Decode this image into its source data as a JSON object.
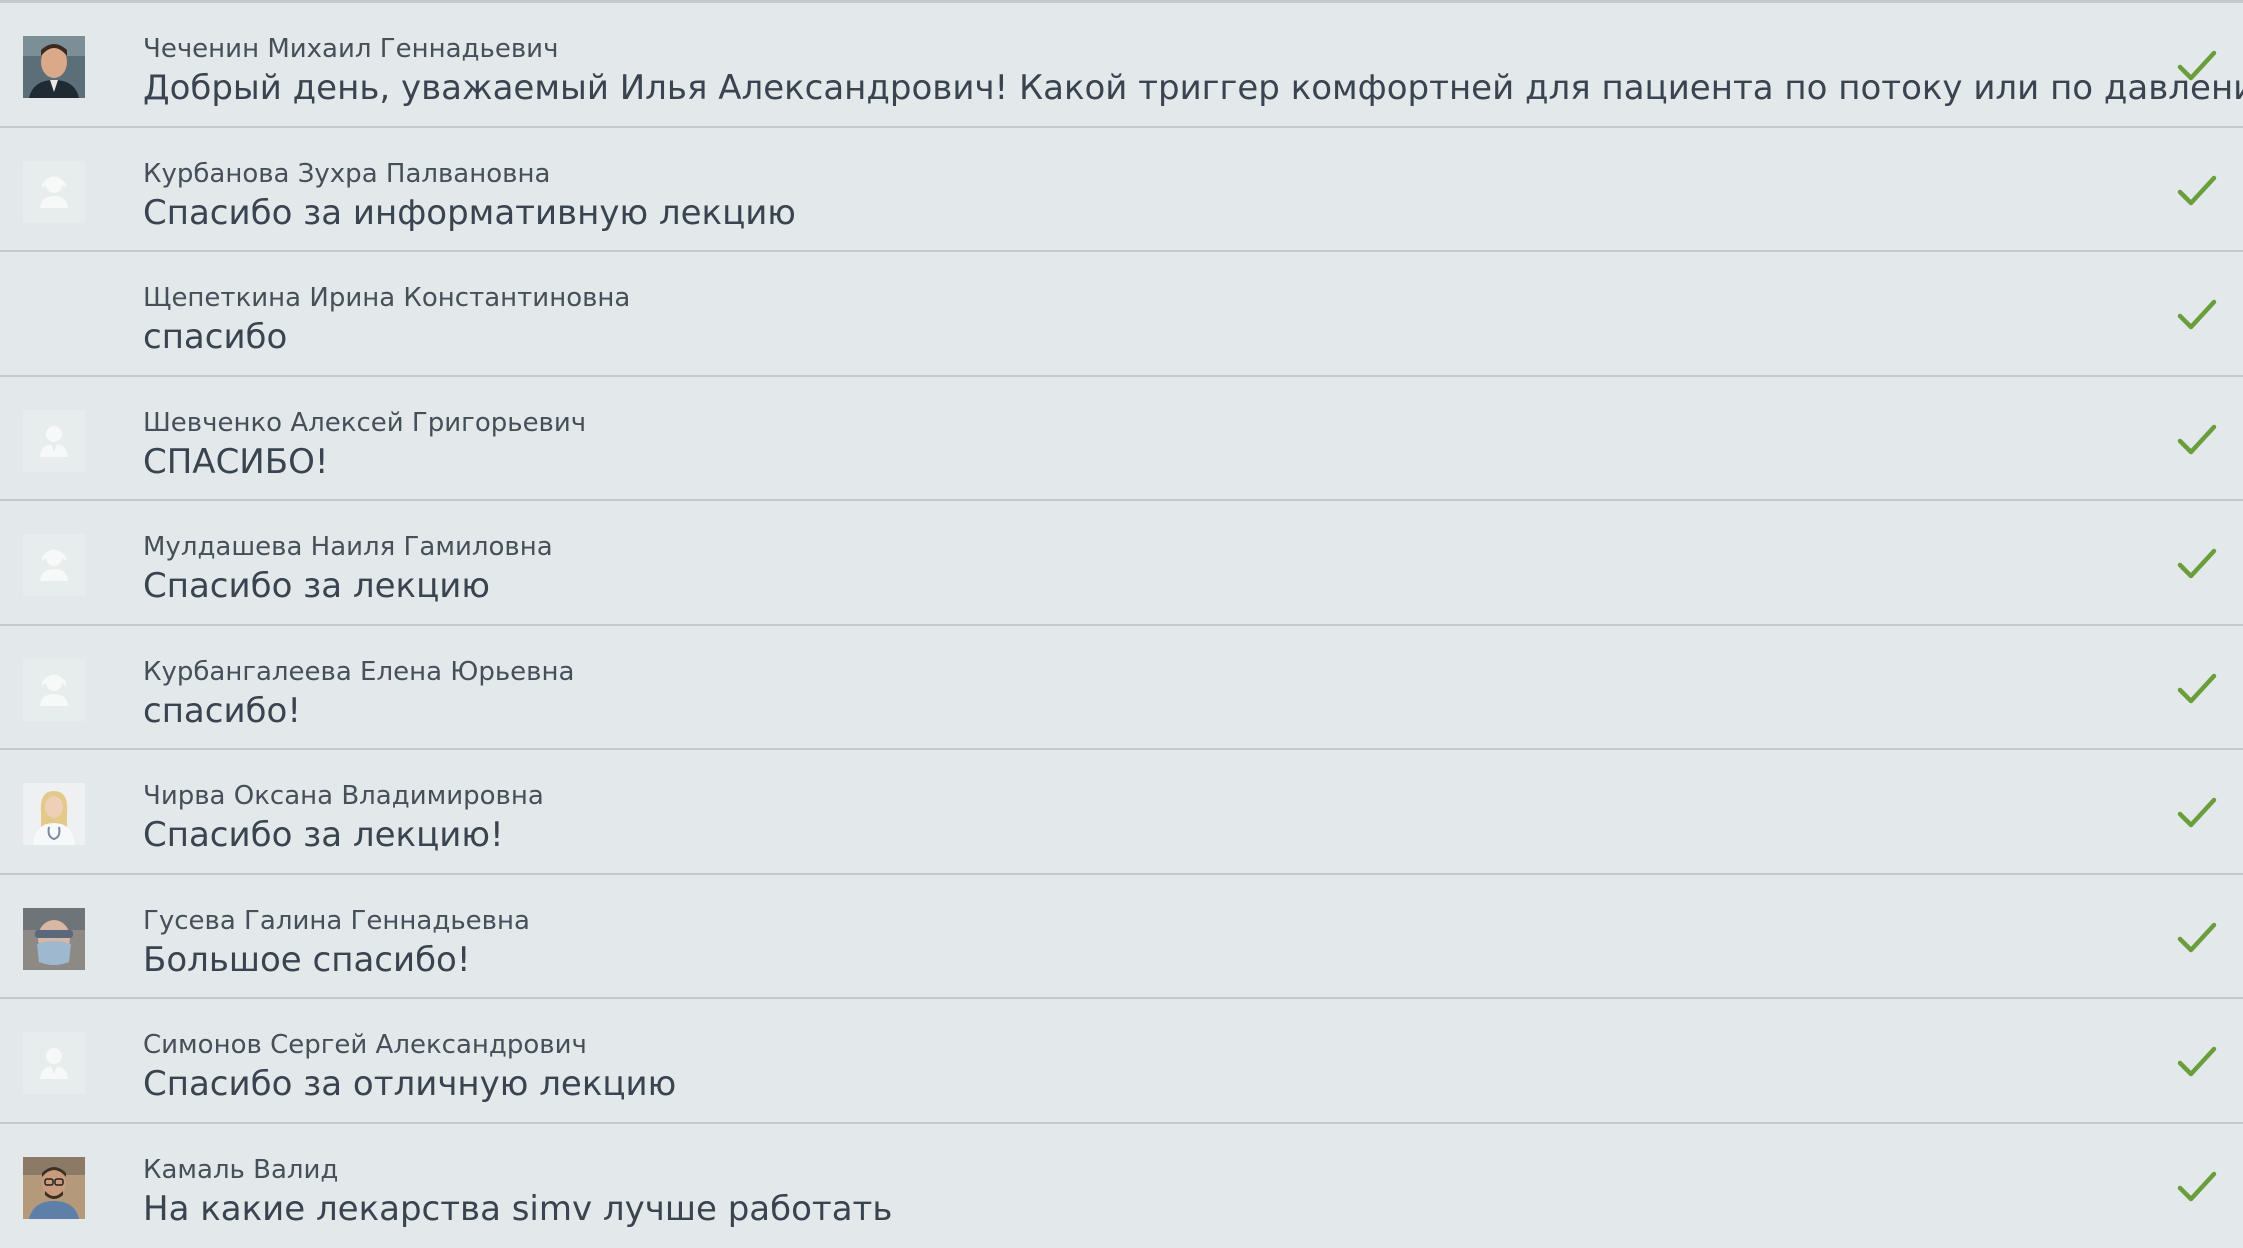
{
  "colors": {
    "background": "#e3e9ea",
    "divider": "#c4cacc",
    "check": "#6a9e3c",
    "text": "#3a4450"
  },
  "messages": [
    {
      "author": "Чеченин Михаил Геннадьевич",
      "text": "Добрый день, уважаемый Илья Александрович! Какой триггер комфортней для пациента по потоку или по давлению?",
      "avatar": "photo-man-suit",
      "status_icon": "check-icon"
    },
    {
      "author": "Курбанова Зухра Палвановна",
      "text": "Спасибо за информативную лекцию",
      "avatar": "placeholder-female",
      "status_icon": "check-icon"
    },
    {
      "author": "Щепеткина Ирина Константиновна",
      "text": "спасибо",
      "avatar": "none",
      "status_icon": "check-icon"
    },
    {
      "author": "Шевченко Алексей Григорьевич",
      "text": "СПАСИБО!",
      "avatar": "placeholder-male",
      "status_icon": "check-icon"
    },
    {
      "author": "Мулдашева Наиля Гамиловна",
      "text": "Спасибо за лекцию",
      "avatar": "placeholder-female",
      "status_icon": "check-icon"
    },
    {
      "author": "Курбангалеева Елена Юрьевна",
      "text": "спасибо!",
      "avatar": "placeholder-female",
      "status_icon": "check-icon"
    },
    {
      "author": "Чирва Оксана Владимировна",
      "text": "Спасибо за лекцию!",
      "avatar": "photo-woman-blonde",
      "status_icon": "check-icon"
    },
    {
      "author": "Гусева Галина Геннадьевна",
      "text": "Большое спасибо!",
      "avatar": "photo-person-mask",
      "status_icon": "check-icon"
    },
    {
      "author": "Симонов Сергей Александрович",
      "text": "Спасибо за отличную лекцию",
      "avatar": "placeholder-male",
      "status_icon": "check-icon"
    },
    {
      "author": "Камаль Валид",
      "text": "На какие лекарства simv лучше работать",
      "avatar": "photo-man-glasses",
      "status_icon": "check-icon"
    }
  ]
}
